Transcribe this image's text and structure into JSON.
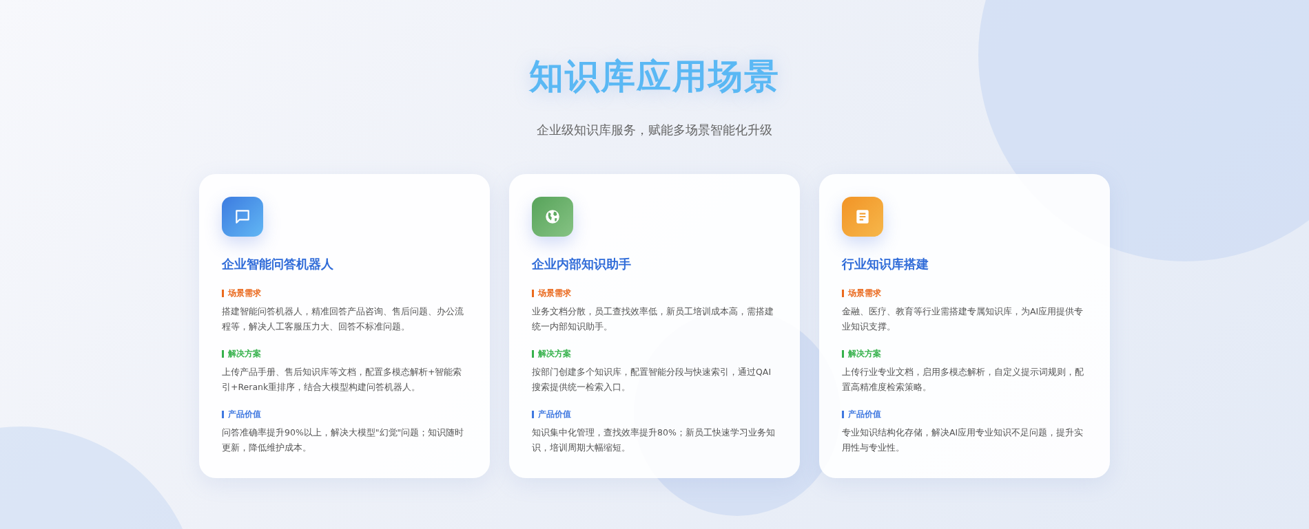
{
  "header": {
    "title": "知识库应用场景",
    "subtitle": "企业级知识库服务，赋能多场景智能化升级"
  },
  "cards": [
    {
      "kind": "chat",
      "title": "企业智能问答机器人",
      "sections": [
        {
          "kind": "need",
          "label": "场景需求",
          "text": "搭建智能问答机器人，精准回答产品咨询、售后问题、办公流程等，解决人工客服压力大、回答不标准问题。"
        },
        {
          "kind": "solution",
          "label": "解决方案",
          "text": "上传产品手册、售后知识库等文档，配置多模态解析+智能索引+Rerank重排序，结合大模型构建问答机器人。"
        },
        {
          "kind": "value",
          "label": "产品价值",
          "text": "问答准确率提升90%以上，解决大模型\"幻觉\"问题；知识随时更新，降低维护成本。"
        }
      ]
    },
    {
      "kind": "globe",
      "title": "企业内部知识助手",
      "sections": [
        {
          "kind": "need",
          "label": "场景需求",
          "text": "业务文档分散，员工查找效率低，新员工培训成本高，需搭建统一内部知识助手。"
        },
        {
          "kind": "solution",
          "label": "解决方案",
          "text": "按部门创建多个知识库，配置智能分段与快速索引，通过QAI搜索提供统一检索入口。"
        },
        {
          "kind": "value",
          "label": "产品价值",
          "text": "知识集中化管理，查找效率提升80%；新员工快速学习业务知识，培训周期大幅缩短。"
        }
      ]
    },
    {
      "kind": "document",
      "title": "行业知识库搭建",
      "sections": [
        {
          "kind": "need",
          "label": "场景需求",
          "text": "金融、医疗、教育等行业需搭建专属知识库，为AI应用提供专业知识支撑。"
        },
        {
          "kind": "solution",
          "label": "解决方案",
          "text": "上传行业专业文档，启用多模态解析，自定义提示词规则，配置高精准度检索策略。"
        },
        {
          "kind": "value",
          "label": "产品价值",
          "text": "专业知识结构化存储，解决AI应用专业知识不足问题，提升实用性与专业性。"
        }
      ]
    }
  ]
}
